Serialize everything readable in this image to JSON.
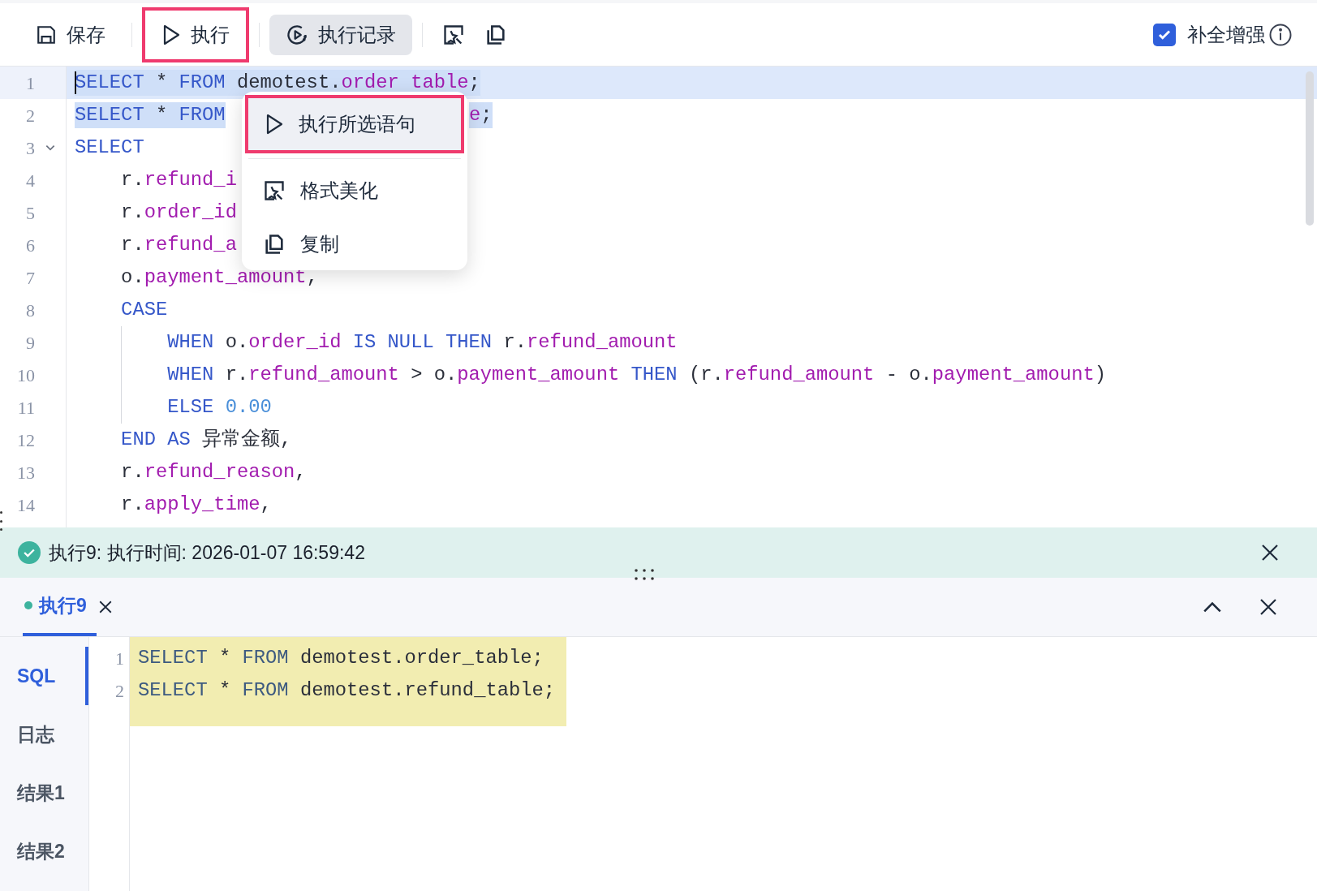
{
  "toolbar": {
    "buttons": [
      {
        "kind": "save",
        "label": "保存",
        "highlighted": false
      },
      {
        "kind": "run",
        "label": "执行",
        "highlighted": true
      },
      {
        "kind": "history",
        "label": "执行记录",
        "highlighted": false
      },
      {
        "kind": "format",
        "highlighted": false
      },
      {
        "kind": "copy",
        "highlighted": false
      }
    ],
    "completion": {
      "label": "补全增强",
      "checked": true
    }
  },
  "editor": {
    "lines": [
      {
        "number": "1",
        "current": true,
        "selected": true,
        "tokens": [
          {
            "kind": "keyword",
            "s": "SELECT"
          },
          {
            "kind": "plain",
            "s": " * "
          },
          {
            "kind": "keyword",
            "s": "FROM"
          },
          {
            "kind": "plain",
            "s": " demotest."
          },
          {
            "kind": "ident",
            "s": "order table"
          },
          {
            "kind": "plain",
            "s": ";"
          }
        ]
      },
      {
        "number": "2",
        "current": false,
        "selected": true,
        "tokens": [
          {
            "kind": "keyword",
            "s": "SELECT"
          },
          {
            "kind": "plain",
            "s": " * "
          },
          {
            "kind": "keyword",
            "s": "FROM"
          }
        ],
        "after_menu": [
          {
            "kind": "ident",
            "s": "e"
          },
          {
            "kind": "plain",
            "s": ";"
          }
        ]
      },
      {
        "number": "3",
        "current": false,
        "selected": false,
        "expanded": true,
        "tokens": [
          {
            "kind": "keyword",
            "s": "SELECT"
          }
        ]
      },
      {
        "number": "4",
        "current": false,
        "selected": false,
        "tokens": [
          {
            "kind": "plain",
            "s": "    r."
          },
          {
            "kind": "ident",
            "s": "refund_i"
          }
        ]
      },
      {
        "number": "5",
        "current": false,
        "selected": false,
        "tokens": [
          {
            "kind": "plain",
            "s": "    r."
          },
          {
            "kind": "ident",
            "s": "order_id"
          }
        ]
      },
      {
        "number": "6",
        "current": false,
        "selected": false,
        "tokens": [
          {
            "kind": "plain",
            "s": "    r."
          },
          {
            "kind": "ident",
            "s": "refund_a"
          }
        ]
      },
      {
        "number": "7",
        "current": false,
        "selected": false,
        "tokens": [
          {
            "kind": "plain",
            "s": "    o."
          },
          {
            "kind": "ident",
            "s": "payment_amount"
          },
          {
            "kind": "plain",
            "s": ","
          }
        ]
      },
      {
        "number": "8",
        "current": false,
        "selected": false,
        "tokens": [
          {
            "kind": "keyword",
            "s": "    CASE"
          }
        ]
      },
      {
        "number": "9",
        "current": false,
        "selected": false,
        "tokens": [
          {
            "kind": "keyword",
            "s": "        WHEN"
          },
          {
            "kind": "plain",
            "s": " o."
          },
          {
            "kind": "ident",
            "s": "order_id"
          },
          {
            "kind": "keyword",
            "s": " IS NULL THEN"
          },
          {
            "kind": "plain",
            "s": " r."
          },
          {
            "kind": "ident",
            "s": "refund_amount"
          }
        ]
      },
      {
        "number": "10",
        "current": false,
        "selected": false,
        "tokens": [
          {
            "kind": "keyword",
            "s": "        WHEN"
          },
          {
            "kind": "plain",
            "s": " r."
          },
          {
            "kind": "ident",
            "s": "refund_amount"
          },
          {
            "kind": "plain",
            "s": " > o."
          },
          {
            "kind": "ident",
            "s": "payment_amount"
          },
          {
            "kind": "keyword",
            "s": " THEN"
          },
          {
            "kind": "plain",
            "s": " (r."
          },
          {
            "kind": "ident",
            "s": "refund_amount"
          },
          {
            "kind": "plain",
            "s": " - o."
          },
          {
            "kind": "ident",
            "s": "payment_amount"
          },
          {
            "kind": "plain",
            "s": ")"
          }
        ]
      },
      {
        "number": "11",
        "current": false,
        "selected": false,
        "tokens": [
          {
            "kind": "keyword",
            "s": "        ELSE"
          },
          {
            "kind": "number",
            "s": " 0.00"
          }
        ]
      },
      {
        "number": "12",
        "current": false,
        "selected": false,
        "tokens": [
          {
            "kind": "keyword",
            "s": "    END AS"
          },
          {
            "kind": "plain",
            "s": " 异常金额,"
          }
        ]
      },
      {
        "number": "13",
        "current": false,
        "selected": false,
        "tokens": [
          {
            "kind": "plain",
            "s": "    r."
          },
          {
            "kind": "ident",
            "s": "refund_reason"
          },
          {
            "kind": "plain",
            "s": ","
          }
        ]
      },
      {
        "number": "14",
        "current": false,
        "selected": false,
        "tokens": [
          {
            "kind": "plain",
            "s": "    r."
          },
          {
            "kind": "ident",
            "s": "apply_time"
          },
          {
            "kind": "plain",
            "s": ","
          }
        ]
      }
    ]
  },
  "context_menu": {
    "items": [
      {
        "kind": "run",
        "label": "执行所选语句",
        "highlighted": true
      },
      {
        "kind": "format",
        "label": "格式美化",
        "highlighted": false
      },
      {
        "kind": "copy",
        "label": "复制",
        "highlighted": false
      }
    ]
  },
  "status": {
    "kind": "success",
    "text": "执行9: 执行时间: 2026-01-07 16:59:42"
  },
  "result_tabs": [
    {
      "label": "执行9",
      "selected": true
    }
  ],
  "side_nav": [
    {
      "label": "SQL",
      "selected": true
    },
    {
      "label": "日志",
      "selected": false
    },
    {
      "label": "结果1",
      "selected": false
    },
    {
      "label": "结果2",
      "selected": false
    }
  ],
  "sql_view": {
    "lines": [
      {
        "number": "1",
        "tokens": [
          {
            "kind": "keyword",
            "s": "SELECT"
          },
          {
            "kind": "plain",
            "s": " * "
          },
          {
            "kind": "keyword",
            "s": "FROM"
          },
          {
            "kind": "plain",
            "s": " demotest.order_table;"
          }
        ]
      },
      {
        "number": "2",
        "tokens": [
          {
            "kind": "keyword",
            "s": "SELECT"
          },
          {
            "kind": "plain",
            "s": " * "
          },
          {
            "kind": "keyword",
            "s": "FROM"
          },
          {
            "kind": "plain",
            "s": " demotest.refund_table;"
          }
        ]
      }
    ]
  }
}
